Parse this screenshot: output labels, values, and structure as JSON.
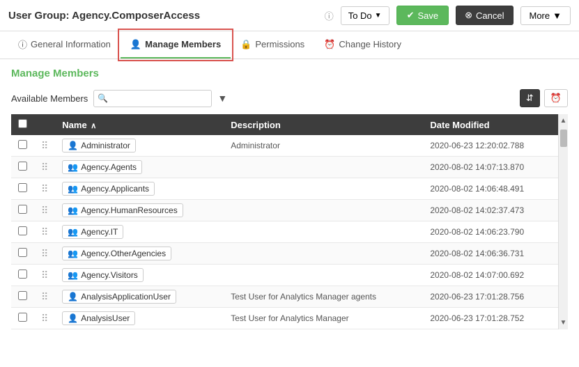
{
  "header": {
    "title": "User Group: Agency.ComposerAccess",
    "help_icon": "?",
    "todo_label": "To Do",
    "save_label": "Save",
    "cancel_label": "Cancel",
    "more_label": "More"
  },
  "tabs": [
    {
      "id": "general-information",
      "label": "General Information",
      "icon": "info",
      "active": false
    },
    {
      "id": "manage-members",
      "label": "Manage Members",
      "icon": "user",
      "active": true
    },
    {
      "id": "permissions",
      "label": "Permissions",
      "icon": "lock",
      "active": false
    },
    {
      "id": "change-history",
      "label": "Change History",
      "icon": "clock",
      "active": false
    }
  ],
  "section_title": "Manage Members",
  "available_members_label": "Available Members",
  "search_placeholder": "",
  "table": {
    "columns": [
      {
        "id": "checkbox",
        "label": ""
      },
      {
        "id": "drag",
        "label": ""
      },
      {
        "id": "name",
        "label": "Name",
        "sortable": true,
        "sorted": "asc"
      },
      {
        "id": "description",
        "label": "Description"
      },
      {
        "id": "date_modified",
        "label": "Date Modified"
      }
    ],
    "rows": [
      {
        "name": "Administrator",
        "description": "Administrator",
        "date_modified": "2020-06-23 12:20:02.788",
        "icon_type": "user"
      },
      {
        "name": "Agency.Agents",
        "description": "",
        "date_modified": "2020-08-02 14:07:13.870",
        "icon_type": "group"
      },
      {
        "name": "Agency.Applicants",
        "description": "",
        "date_modified": "2020-08-02 14:06:48.491",
        "icon_type": "group"
      },
      {
        "name": "Agency.HumanResources",
        "description": "",
        "date_modified": "2020-08-02 14:02:37.473",
        "icon_type": "group"
      },
      {
        "name": "Agency.IT",
        "description": "",
        "date_modified": "2020-08-02 14:06:23.790",
        "icon_type": "group"
      },
      {
        "name": "Agency.OtherAgencies",
        "description": "",
        "date_modified": "2020-08-02 14:06:36.731",
        "icon_type": "group"
      },
      {
        "name": "Agency.Visitors",
        "description": "",
        "date_modified": "2020-08-02 14:07:00.692",
        "icon_type": "group"
      },
      {
        "name": "AnalysisApplicationUser",
        "description": "Test User for Analytics Manager agents",
        "date_modified": "2020-06-23 17:01:28.756",
        "icon_type": "user"
      },
      {
        "name": "AnalysisUser",
        "description": "Test User for Analytics Manager",
        "date_modified": "2020-06-23 17:01:28.752",
        "icon_type": "user"
      }
    ]
  }
}
